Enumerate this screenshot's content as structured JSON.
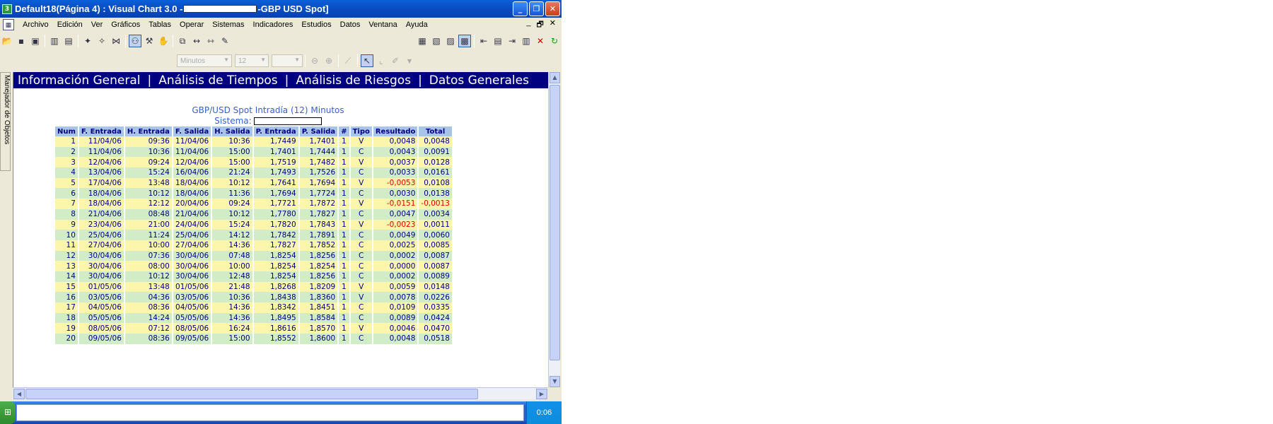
{
  "window": {
    "title_left": "Default18(Página 4) : Visual Chart  3.0 -",
    "title_right": "-GBP USD Spot]",
    "app_icon": "visual-chart-icon",
    "controls": [
      "minimize-icon",
      "restore-icon",
      "close-icon"
    ]
  },
  "menu": {
    "items": [
      "Archivo",
      "Edición",
      "Ver",
      "Gráficos",
      "Tablas",
      "Operar",
      "Sistemas",
      "Indicadores",
      "Estudios",
      "Datos",
      "Ventana",
      "Ayuda"
    ],
    "mdi_controls": [
      "_",
      "🗗",
      "✕"
    ]
  },
  "toolbar2": {
    "interval": "Minutos",
    "interval_value": "12",
    "third_combo": ""
  },
  "sidebar": {
    "tab_label": "Manejador de Objetos"
  },
  "nav": {
    "items": [
      "Información General",
      "Análisis de Tiempos",
      "Análisis de Riesgos",
      "Datos Generales"
    ],
    "separator": "|"
  },
  "report": {
    "title": "GBP/USD Spot Intradía (12) Minutos",
    "sistema_label": "Sistema:",
    "sistema_value": ""
  },
  "table": {
    "columns": [
      "Num",
      "F. Entrada",
      "H. Entrada",
      "F. Salida",
      "H. Salida",
      "P. Entrada",
      "P. Salida",
      "#",
      "Tipo",
      "Resultado",
      "Total"
    ],
    "rows": [
      [
        "1",
        "11/04/06",
        "09:36",
        "11/04/06",
        "10:36",
        "1,7449",
        "1,7401",
        "1",
        "V",
        "0,0048",
        "0,0048"
      ],
      [
        "2",
        "11/04/06",
        "10:36",
        "11/04/06",
        "15:00",
        "1,7401",
        "1,7444",
        "1",
        "C",
        "0,0043",
        "0,0091"
      ],
      [
        "3",
        "12/04/06",
        "09:24",
        "12/04/06",
        "15:00",
        "1,7519",
        "1,7482",
        "1",
        "V",
        "0,0037",
        "0,0128"
      ],
      [
        "4",
        "13/04/06",
        "15:24",
        "16/04/06",
        "21:24",
        "1,7493",
        "1,7526",
        "1",
        "C",
        "0,0033",
        "0,0161"
      ],
      [
        "5",
        "17/04/06",
        "13:48",
        "18/04/06",
        "10:12",
        "1,7641",
        "1,7694",
        "1",
        "V",
        "-0,0053",
        "0,0108"
      ],
      [
        "6",
        "18/04/06",
        "10:12",
        "18/04/06",
        "11:36",
        "1,7694",
        "1,7724",
        "1",
        "C",
        "0,0030",
        "0,0138"
      ],
      [
        "7",
        "18/04/06",
        "12:12",
        "20/04/06",
        "09:24",
        "1,7721",
        "1,7872",
        "1",
        "V",
        "-0,0151",
        "-0,0013"
      ],
      [
        "8",
        "21/04/06",
        "08:48",
        "21/04/06",
        "10:12",
        "1,7780",
        "1,7827",
        "1",
        "C",
        "0,0047",
        "0,0034"
      ],
      [
        "9",
        "23/04/06",
        "21:00",
        "24/04/06",
        "15:24",
        "1,7820",
        "1,7843",
        "1",
        "V",
        "-0,0023",
        "0,0011"
      ],
      [
        "10",
        "25/04/06",
        "11:24",
        "25/04/06",
        "14:12",
        "1,7842",
        "1,7891",
        "1",
        "C",
        "0,0049",
        "0,0060"
      ],
      [
        "11",
        "27/04/06",
        "10:00",
        "27/04/06",
        "14:36",
        "1,7827",
        "1,7852",
        "1",
        "C",
        "0,0025",
        "0,0085"
      ],
      [
        "12",
        "30/04/06",
        "07:36",
        "30/04/06",
        "07:48",
        "1,8254",
        "1,8256",
        "1",
        "C",
        "0,0002",
        "0,0087"
      ],
      [
        "13",
        "30/04/06",
        "08:00",
        "30/04/06",
        "10:00",
        "1,8254",
        "1,8254",
        "1",
        "C",
        "0,0000",
        "0,0087"
      ],
      [
        "14",
        "30/04/06",
        "10:12",
        "30/04/06",
        "12:48",
        "1,8254",
        "1,8256",
        "1",
        "C",
        "0,0002",
        "0,0089"
      ],
      [
        "15",
        "01/05/06",
        "13:48",
        "01/05/06",
        "21:48",
        "1,8268",
        "1,8209",
        "1",
        "V",
        "0,0059",
        "0,0148"
      ],
      [
        "16",
        "03/05/06",
        "04:36",
        "03/05/06",
        "10:36",
        "1,8438",
        "1,8360",
        "1",
        "V",
        "0,0078",
        "0,0226"
      ],
      [
        "17",
        "04/05/06",
        "08:36",
        "04/05/06",
        "14:36",
        "1,8342",
        "1,8451",
        "1",
        "C",
        "0,0109",
        "0,0335"
      ],
      [
        "18",
        "05/05/06",
        "14:24",
        "05/05/06",
        "14:36",
        "1,8495",
        "1,8584",
        "1",
        "C",
        "0,0089",
        "0,0424"
      ],
      [
        "19",
        "08/05/06",
        "07:12",
        "08/05/06",
        "16:24",
        "1,8616",
        "1,8570",
        "1",
        "V",
        "0,0046",
        "0,0470"
      ],
      [
        "20",
        "09/05/06",
        "08:36",
        "09/05/06",
        "15:00",
        "1,8552",
        "1,8600",
        "1",
        "C",
        "0,0048",
        "0,0518"
      ]
    ]
  },
  "colors": {
    "nav_background": "#000080",
    "header_cell": "#a8c4e6",
    "row_odd": "#fbf6ab",
    "row_even": "#d2ecc7",
    "negative": "#e00000",
    "text": "#000080"
  },
  "taskbar": {
    "clock": "0:06"
  }
}
